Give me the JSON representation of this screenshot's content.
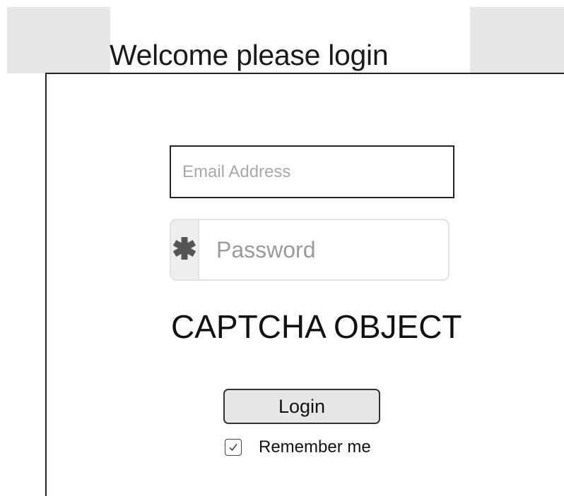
{
  "header": {
    "title": "Welcome please login"
  },
  "form": {
    "email": {
      "value": "",
      "placeholder": "Email Address"
    },
    "password": {
      "value": "",
      "placeholder": "Password",
      "icon": "asterisk-icon"
    },
    "captcha": {
      "label": "CAPTCHA OBJECT"
    },
    "login_button": {
      "label": "Login"
    },
    "remember_me": {
      "label": "Remember me",
      "checked": true,
      "icon": "checkmark-icon"
    }
  },
  "colors": {
    "border": "#222222",
    "placeholder": "#a8a8a8",
    "button_bg": "#e6e6e6",
    "addon_bg": "#eeeeee",
    "background_block": "#e6e6e6"
  }
}
